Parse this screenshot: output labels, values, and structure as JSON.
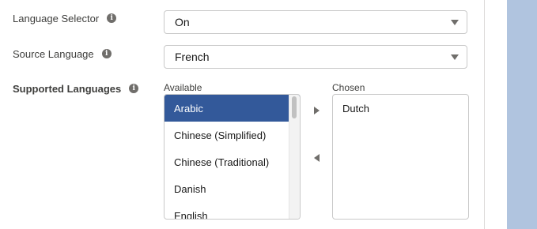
{
  "fields": {
    "language_selector": {
      "label": "Language Selector",
      "value": "On"
    },
    "source_language": {
      "label": "Source Language",
      "value": "French"
    },
    "supported_languages": {
      "label": "Supported Languages",
      "available_heading": "Available",
      "chosen_heading": "Chosen",
      "available": [
        "Arabic",
        "Chinese (Simplified)",
        "Chinese (Traditional)",
        "Danish",
        "English"
      ],
      "selected_available": "Arabic",
      "chosen": [
        "Dutch"
      ]
    }
  },
  "icons": {
    "info": "i",
    "move_right": "triangle-right-icon",
    "move_left": "triangle-left-icon",
    "dropdown": "chevron-down-icon"
  },
  "colors": {
    "selected_item_bg": "#33599a",
    "side_background": "#b0c4df",
    "icon_gray": "#706e6b"
  }
}
